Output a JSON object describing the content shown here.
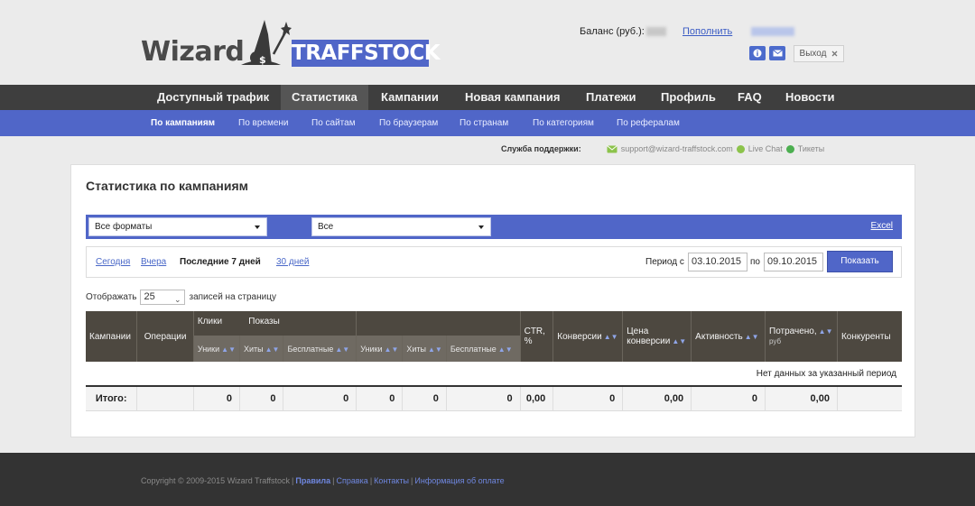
{
  "logo": {
    "wizard": "Wizard",
    "traffstock": "TRAFFSTOCK"
  },
  "header": {
    "balance_label": "Баланс (руб.):",
    "topup_label": "Пополнить",
    "logout_label": "Выход",
    "logout_icon": "close-icon",
    "info_icon": "info-icon",
    "mail_icon": "mail-icon"
  },
  "nav": {
    "items": [
      {
        "label": "Доступный трафик"
      },
      {
        "label": "Статистика",
        "active": true
      },
      {
        "label": "Кампании"
      },
      {
        "label": "Новая кампания"
      },
      {
        "label": "Платежи"
      },
      {
        "label": "Профиль"
      },
      {
        "label": "FAQ"
      },
      {
        "label": "Новости"
      }
    ]
  },
  "subnav": {
    "items": [
      {
        "label": "По кампаниям",
        "active": true
      },
      {
        "label": "По времени"
      },
      {
        "label": "По сайтам"
      },
      {
        "label": "По браузерам"
      },
      {
        "label": "По странам"
      },
      {
        "label": "По категориям"
      },
      {
        "label": "По рефералам"
      }
    ]
  },
  "support": {
    "label": "Служба поддержки:",
    "email": "support@wizard-traffstock.com",
    "chat": "Live Chat",
    "tickets": "Тикеты"
  },
  "main": {
    "title": "Статистика по кампаниям",
    "filters": {
      "format": "Все форматы",
      "second": "Все",
      "excel": "Excel"
    },
    "period": {
      "today": "Сегодня",
      "yesterday": "Вчера",
      "last7": "Последние 7 дней",
      "last30": "30 дней",
      "from_label": "Период с",
      "from": "03.10.2015",
      "to_label": "по",
      "to": "09.10.2015",
      "show": "Показать"
    },
    "perpage": {
      "label_before": "Отображать",
      "value": "25",
      "label_after": "записей на страницу"
    }
  },
  "table": {
    "headers": {
      "campaigns": "Кампании",
      "operations": "Операции",
      "clicks": "Клики",
      "impressions": "Показы",
      "ctr": "CTR,",
      "ctr_unit": "%",
      "conversions": "Конверсии",
      "conv_price_1": "Цена",
      "conv_price_2": "конверсии",
      "activity": "Активность",
      "spent": "Потрачено,",
      "spent_unit": "руб",
      "competitors": "Конкуренты"
    },
    "subheaders": {
      "uniques_1": "Уники",
      "hits_1": "Хиты",
      "free_1": "Бесплатные",
      "uniques_2": "Уники",
      "hits_2": "Хиты",
      "free_2": "Бесплатные"
    },
    "empty": "Нет данных за указанный период",
    "total": {
      "label": "Итого:",
      "c_uniq": "0",
      "c_hits": "0",
      "c_free": "0",
      "i_uniq": "0",
      "i_hits": "0",
      "i_free": "0",
      "ctr": "0,00",
      "conv": "0",
      "price": "0,00",
      "activity": "0",
      "spent": "0,00"
    }
  },
  "footer": {
    "copyright": "Copyright © 2009-2015 Wizard Traffstock",
    "rules": "Правила",
    "help": "Справка",
    "contacts": "Контакты",
    "payment": "Информация об оплате"
  },
  "colors": {
    "accent": "#5066c8",
    "nav": "#3e3e3e",
    "footer": "#333333"
  }
}
